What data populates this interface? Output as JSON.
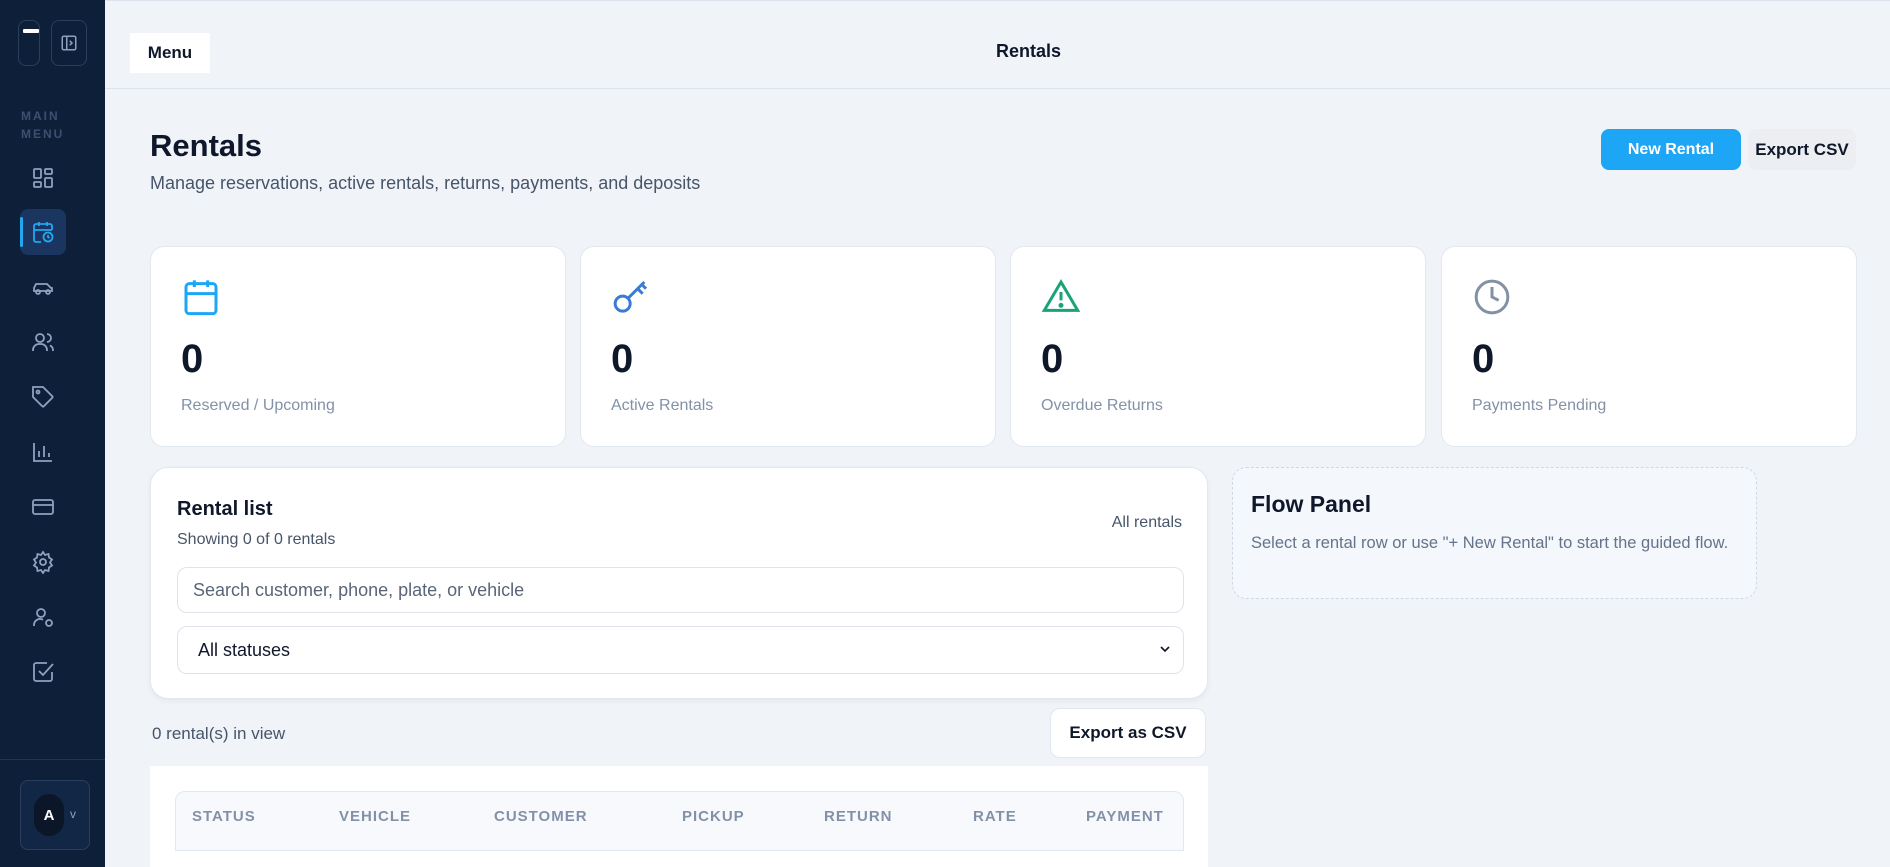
{
  "sidebar": {
    "main_menu_label": "MAIN MENU",
    "nav_items": [
      {
        "icon": "dashboard-icon"
      },
      {
        "icon": "rentals-calendar-icon",
        "active": true
      },
      {
        "icon": "car-icon"
      },
      {
        "icon": "users-icon"
      },
      {
        "icon": "tag-icon"
      },
      {
        "icon": "bar-chart-icon"
      },
      {
        "icon": "credit-card-icon"
      },
      {
        "icon": "gear-icon"
      },
      {
        "icon": "user-settings-icon"
      },
      {
        "icon": "checkbox-icon"
      }
    ],
    "account": {
      "initial": "A",
      "chevron": "v"
    }
  },
  "topbar": {
    "menu_label": "Menu",
    "title": "Rentals"
  },
  "header": {
    "title": "Rentals",
    "subtitle": "Manage reservations, active rentals, returns, payments, and deposits",
    "new_rental_label": "New Rental",
    "export_label": "Export CSV"
  },
  "stats": [
    {
      "icon": "calendar-icon",
      "value": "0",
      "label": "Reserved / Upcoming",
      "color": "#1ca6f5"
    },
    {
      "icon": "key-icon",
      "value": "0",
      "label": "Active Rentals",
      "color": "#3b7bd8"
    },
    {
      "icon": "warning-icon",
      "value": "0",
      "label": "Overdue Returns",
      "color": "#1aa37a"
    },
    {
      "icon": "clock-icon",
      "value": "0",
      "label": "Payments Pending",
      "color": "#8391a7"
    }
  ],
  "rental_list": {
    "title": "Rental list",
    "count_text": "Showing 0 of 0 rentals",
    "scope": "All rentals",
    "search_placeholder": "Search customer, phone, plate, or vehicle",
    "status_filter": "All statuses",
    "in_view_text": "0 rental(s) in view",
    "export_label": "Export as CSV",
    "columns": [
      "STATUS",
      "VEHICLE",
      "CUSTOMER",
      "PICKUP",
      "RETURN",
      "RATE",
      "PAYMENT"
    ]
  },
  "flow_panel": {
    "title": "Flow Panel",
    "text": "Select a rental row or use \"+ New Rental\" to start the guided flow."
  },
  "colors": {
    "sidebar_bg": "#0e1f3a",
    "accent": "#1ca6f5",
    "page_bg": "#f0f3f8"
  }
}
